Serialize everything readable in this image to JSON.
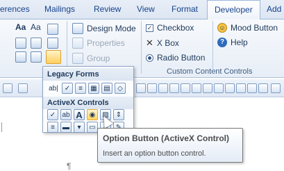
{
  "tabs": [
    {
      "label": "erences"
    },
    {
      "label": "Mailings"
    },
    {
      "label": "Review"
    },
    {
      "label": "View"
    },
    {
      "label": "Format"
    },
    {
      "label": "Developer",
      "active": true
    },
    {
      "label": "Add"
    }
  ],
  "ribbon": {
    "templates": {
      "design_mode": "Design Mode",
      "properties": "Properties",
      "group": "Group"
    },
    "content_controls": {
      "checkbox": "Checkbox",
      "xbox": "X Box",
      "radio_button": "Radio Button",
      "label": "Custom Content Controls"
    },
    "right": {
      "mood_button": "Mood Button",
      "help": "Help"
    }
  },
  "dropdown": {
    "legacy_forms": "Legacy Forms",
    "activex_controls": "ActiveX Controls",
    "legacy_text_ab": "ab|"
  },
  "tooltip": {
    "title": "Option Button (ActiveX Control)",
    "description": "Insert an option button control."
  },
  "document": {
    "pilcrow": "¶"
  },
  "colors": {
    "tab_text": "#15428b",
    "ribbon_top": "#f7f9fc",
    "highlight": "#ffd565"
  }
}
